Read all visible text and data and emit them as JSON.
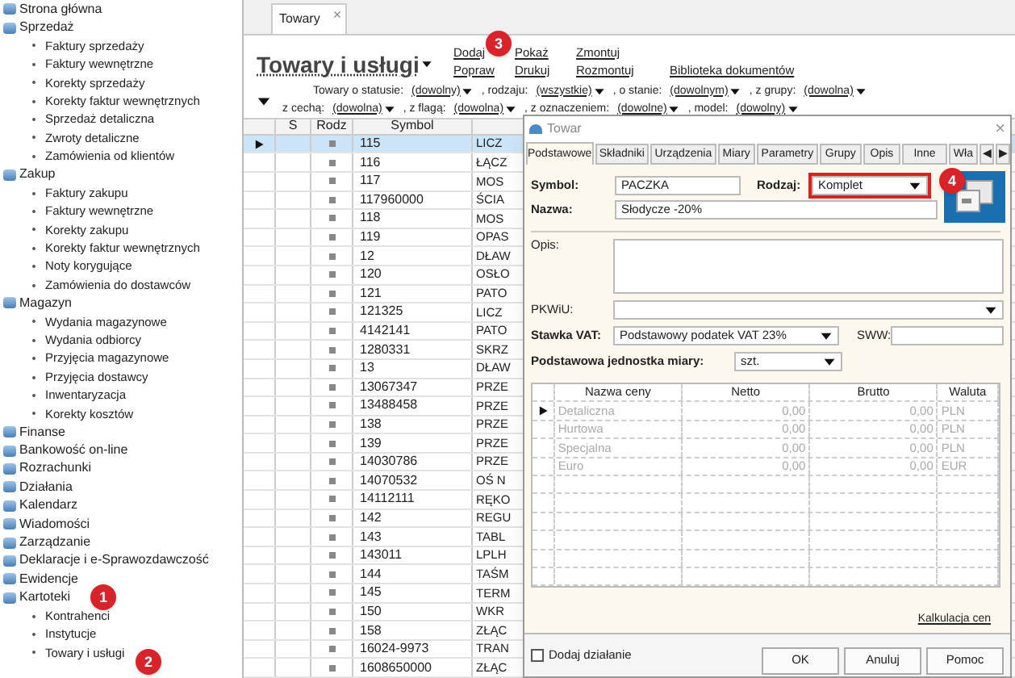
{
  "sidebar": {
    "items": [
      {
        "label": "Strona główna"
      },
      {
        "label": "Sprzedaż",
        "children": [
          {
            "label": "Faktury sprzedaży"
          },
          {
            "label": "Faktury wewnętrzne"
          },
          {
            "label": "Korekty sprzedaży"
          },
          {
            "label": "Korekty faktur wewnętrznych"
          },
          {
            "label": "Sprzedaż detaliczna"
          },
          {
            "label": "Zwroty detaliczne"
          },
          {
            "label": "Zamówienia od klientów"
          }
        ]
      },
      {
        "label": "Zakup",
        "children": [
          {
            "label": "Faktury zakupu"
          },
          {
            "label": "Faktury wewnętrzne"
          },
          {
            "label": "Korekty zakupu"
          },
          {
            "label": "Korekty faktur wewnętrznych"
          },
          {
            "label": "Noty korygujące"
          },
          {
            "label": "Zamówienia do dostawców"
          }
        ]
      },
      {
        "label": "Magazyn",
        "children": [
          {
            "label": "Wydania magazynowe"
          },
          {
            "label": "Wydania odbiorcy"
          },
          {
            "label": "Przyjęcia magazynowe"
          },
          {
            "label": "Przyjęcia dostawcy"
          },
          {
            "label": "Inwentaryzacja"
          },
          {
            "label": "Korekty kosztów"
          }
        ]
      },
      {
        "label": "Finanse"
      },
      {
        "label": "Bankowość on-line"
      },
      {
        "label": "Rozrachunki"
      },
      {
        "label": "Działania"
      },
      {
        "label": "Kalendarz"
      },
      {
        "label": "Wiadomości"
      },
      {
        "label": "Zarządzanie"
      },
      {
        "label": "Deklaracje i e-Sprawozdawczość"
      },
      {
        "label": "Ewidencje"
      },
      {
        "label": "Kartoteki",
        "children": [
          {
            "label": "Kontrahenci"
          },
          {
            "label": "Instytucje"
          },
          {
            "label": "Towary i usługi"
          }
        ]
      }
    ]
  },
  "tab": {
    "label": "Towary",
    "close": "×"
  },
  "title": "Towary i usługi",
  "actions": [
    [
      "Dodaj",
      "Popraw"
    ],
    [
      "Pokaż",
      "Drukuj"
    ],
    [
      "Zmontuj",
      "Rozmontuj"
    ],
    [
      "Biblioteka dokumentów"
    ]
  ],
  "filters": [
    [
      {
        "label": "Towary o statusie:",
        "value": "(dowolny)"
      },
      {
        "label": ", rodzaju:",
        "value": "(wszystkie)"
      },
      {
        "label": ", o stanie:",
        "value": "(dowolnym)"
      },
      {
        "label": ", z grupy:",
        "value": "(dowolna)"
      }
    ],
    [
      {
        "label": "z cechą:",
        "value": "(dowolna)"
      },
      {
        "label": ", z flagą:",
        "value": "(dowolna)"
      },
      {
        "label": ", z oznaczeniem:",
        "value": "(dowolne)"
      },
      {
        "label": ", model:",
        "value": "(dowolny)"
      }
    ]
  ],
  "table": {
    "columns": [
      "S",
      "Rodz",
      "Symbol"
    ],
    "rows": [
      {
        "symbol": "115",
        "name": "LICZ",
        "selected": true
      },
      {
        "symbol": "116",
        "name": "ŁĄCZ",
        "selected": false
      },
      {
        "symbol": "117",
        "name": "MOS",
        "selected": false
      },
      {
        "symbol": "117960000",
        "name": "ŚCIA",
        "selected": false
      },
      {
        "symbol": "118",
        "name": "MOS",
        "selected": false
      },
      {
        "symbol": "119",
        "name": "OPAS",
        "selected": false
      },
      {
        "symbol": "12",
        "name": "DŁAW",
        "selected": false
      },
      {
        "symbol": "120",
        "name": "OSŁO",
        "selected": false
      },
      {
        "symbol": "121",
        "name": "PATO",
        "selected": false
      },
      {
        "symbol": "121325",
        "name": "LICZ",
        "selected": false
      },
      {
        "symbol": "4142141",
        "name": "PATO",
        "selected": false
      },
      {
        "symbol": "1280331",
        "name": "SKRZ",
        "selected": false
      },
      {
        "symbol": "13",
        "name": "DŁAW",
        "selected": false
      },
      {
        "symbol": "13067347",
        "name": "PRZE",
        "selected": false
      },
      {
        "symbol": "13488458",
        "name": "PRZE",
        "selected": false
      },
      {
        "symbol": "138",
        "name": "PRZE",
        "selected": false
      },
      {
        "symbol": "139",
        "name": "PRZE",
        "selected": false
      },
      {
        "symbol": "14030786",
        "name": "PRZE",
        "selected": false
      },
      {
        "symbol": "14070532",
        "name": "OŚ N",
        "selected": false
      },
      {
        "symbol": "14112111",
        "name": "RĘKO",
        "selected": false
      },
      {
        "symbol": "142",
        "name": "REGU",
        "selected": false
      },
      {
        "symbol": "143",
        "name": "TABL",
        "selected": false
      },
      {
        "symbol": "143011",
        "name": "LPLH",
        "selected": false
      },
      {
        "symbol": "144",
        "name": "TAŚM",
        "selected": false
      },
      {
        "symbol": "145",
        "name": "TERM",
        "selected": false
      },
      {
        "symbol": "150",
        "name": "WKR",
        "selected": false
      },
      {
        "symbol": "158",
        "name": "ZŁĄC",
        "selected": false
      },
      {
        "symbol": "16024-9973",
        "name": "TRAN",
        "selected": false
      },
      {
        "symbol": "1608650000",
        "name": "ZŁĄC",
        "selected": false
      }
    ]
  },
  "dialog": {
    "title": "Towar",
    "close": "×",
    "tabs": [
      {
        "label": "Podstawowe",
        "selected": true
      },
      {
        "label": "Składniki",
        "selected": false
      },
      {
        "label": "Urządzenia",
        "selected": false
      },
      {
        "label": "Miary",
        "selected": false
      },
      {
        "label": "Parametry",
        "selected": false
      },
      {
        "label": "Grupy",
        "selected": false
      },
      {
        "label": "Opis",
        "selected": false
      },
      {
        "label": "Inne",
        "selected": false
      },
      {
        "label": "Wła",
        "selected": false
      }
    ],
    "tab_scroll": [
      "◀",
      "▶"
    ],
    "symbol": {
      "label": "Symbol:",
      "value": "PACZKA"
    },
    "rodzaj": {
      "label": "Rodzaj:",
      "value": "Komplet",
      "highlighted": true
    },
    "nazwa": {
      "label": "Nazwa:",
      "value": "Słodycze -20%"
    },
    "opis": {
      "label": "Opis:"
    },
    "pkwiu": {
      "label": "PKWiU:"
    },
    "vat": {
      "label": "Stawka VAT:",
      "value": "Podstawowy podatek VAT 23%"
    },
    "sww": {
      "label": "SWW:"
    },
    "unit": {
      "label": "Podstawowa jednostka miary:",
      "value": "szt."
    },
    "prices": {
      "columns": [
        "Nazwa ceny",
        "Netto",
        "Brutto",
        "Waluta"
      ],
      "rows": [
        {
          "name": "Detaliczna",
          "netto": "0,00",
          "brutto": "0,00",
          "currency": "PLN",
          "selected": true
        },
        {
          "name": "Hurtowa",
          "netto": "0,00",
          "brutto": "0,00",
          "currency": "PLN",
          "selected": false
        },
        {
          "name": "Specjalna",
          "netto": "0,00",
          "brutto": "0,00",
          "currency": "PLN",
          "selected": false
        },
        {
          "name": "Euro",
          "netto": "0,00",
          "brutto": "0,00",
          "currency": "EUR",
          "selected": false
        }
      ]
    },
    "calc_link": "Kalkulacja cen",
    "add_action": {
      "label": "Dodaj działanie",
      "checked": false
    },
    "buttons": [
      "OK",
      "Anuluj",
      "Pomoc"
    ]
  },
  "callouts": [
    "1",
    "2",
    "3",
    "4"
  ]
}
